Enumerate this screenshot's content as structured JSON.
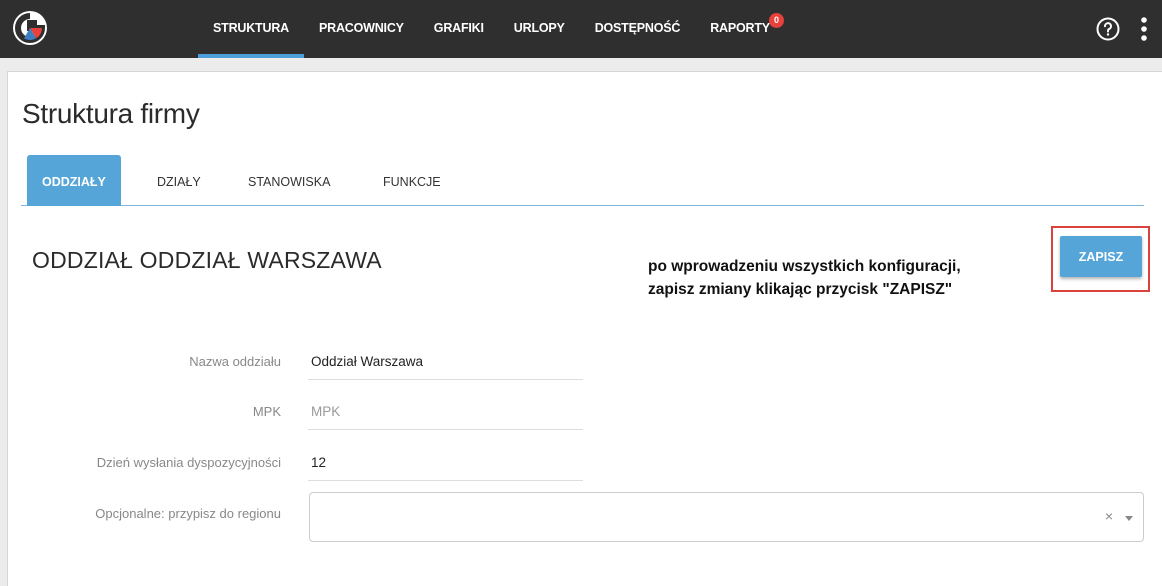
{
  "nav": {
    "items": [
      {
        "label": "STRUKTURA"
      },
      {
        "label": "PRACOWNICY"
      },
      {
        "label": "GRAFIKI"
      },
      {
        "label": "URLOPY"
      },
      {
        "label": "DOSTĘPNOŚĆ"
      },
      {
        "label": "RAPORTY",
        "badge": "0"
      }
    ]
  },
  "page": {
    "title": "Struktura firmy",
    "tabs": [
      {
        "label": "ODDZIAŁY"
      },
      {
        "label": "DZIAŁY"
      },
      {
        "label": "STANOWISKA"
      },
      {
        "label": "FUNKCJE"
      }
    ],
    "section_title": "ODDZIAŁ ODDZIAŁ WARSZAWA",
    "instruction_line1": "po wprowadzeniu wszystkich konfiguracji,",
    "instruction_line2": "zapisz zmiany klikając przycisk \"ZAPISZ\"",
    "save_label": "ZAPISZ"
  },
  "form": {
    "name_label": "Nazwa oddziału",
    "name_value": "Oddział Warszawa",
    "mpk_label": "MPK",
    "mpk_placeholder": "MPK",
    "day_label": "Dzień wysłania dyspozycyjności",
    "day_value": "12",
    "region_label": "Opcjonalne: przypisz do regionu",
    "region_clear": "×"
  },
  "colors": {
    "topbar": "#2f2f2f",
    "accent": "#55a5d9",
    "badge": "#e8403a",
    "highlight": "#d9433c"
  }
}
